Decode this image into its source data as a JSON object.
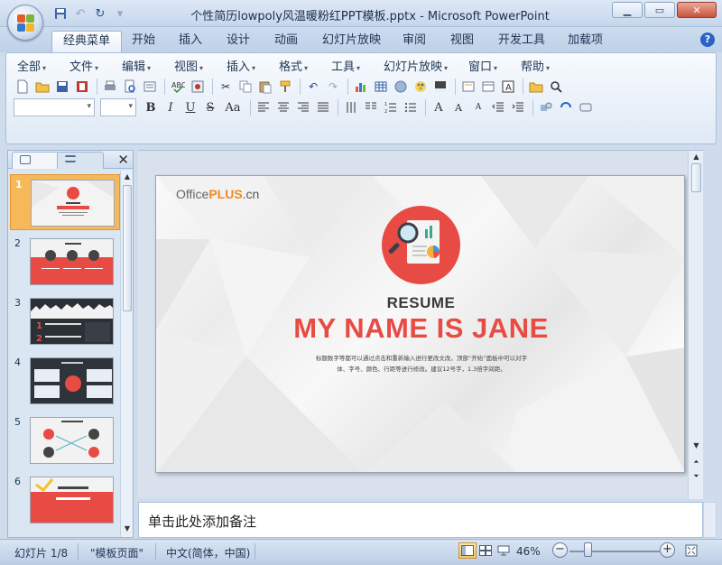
{
  "window": {
    "title": "个性简历lowpoly风温暖粉红PPT模板.pptx - Microsoft PowerPoint",
    "controls": [
      "minimize",
      "maximize",
      "close"
    ]
  },
  "ribbon_tabs": [
    {
      "label": "经典菜单",
      "active": true
    },
    {
      "label": "开始"
    },
    {
      "label": "插入"
    },
    {
      "label": "设计"
    },
    {
      "label": "动画"
    },
    {
      "label": "幻灯片放映"
    },
    {
      "label": "审阅"
    },
    {
      "label": "视图"
    },
    {
      "label": "开发工具"
    },
    {
      "label": "加载项"
    }
  ],
  "menus": [
    {
      "label": "全部"
    },
    {
      "label": "文件"
    },
    {
      "label": "编辑"
    },
    {
      "label": "视图"
    },
    {
      "label": "插入"
    },
    {
      "label": "格式"
    },
    {
      "label": "工具"
    },
    {
      "label": "幻灯片放映"
    },
    {
      "label": "窗口"
    },
    {
      "label": "帮助"
    }
  ],
  "format_buttons": {
    "bold": "B",
    "italic": "I",
    "underline": "U",
    "strike": "S",
    "case": "Aa"
  },
  "slide_pane": {
    "slides": [
      {
        "number": "1",
        "selected": true
      },
      {
        "number": "2"
      },
      {
        "number": "3"
      },
      {
        "number": "4"
      },
      {
        "number": "5"
      },
      {
        "number": "6"
      }
    ]
  },
  "slide": {
    "brand_office": "Office",
    "brand_plus": "PLUS",
    "brand_cn": ".cn",
    "subtitle": "RESUME",
    "title": "MY NAME IS JANE",
    "description_line1": "标题数字等都可以通过点击和重新输入进行更改文改，顶部“开始”面板中可以对字",
    "description_line2": "体、字号、颜色、行距等进行修改。建议12号字，1.3倍字间距。",
    "accent_color": "#e84b44"
  },
  "notes": {
    "placeholder": "单击此处添加备注"
  },
  "status_bar": {
    "slide_indicator": "幻灯片 1/8",
    "theme": "\"模板页面\"",
    "language": "中文(简体，中国)",
    "zoom": "46%"
  }
}
